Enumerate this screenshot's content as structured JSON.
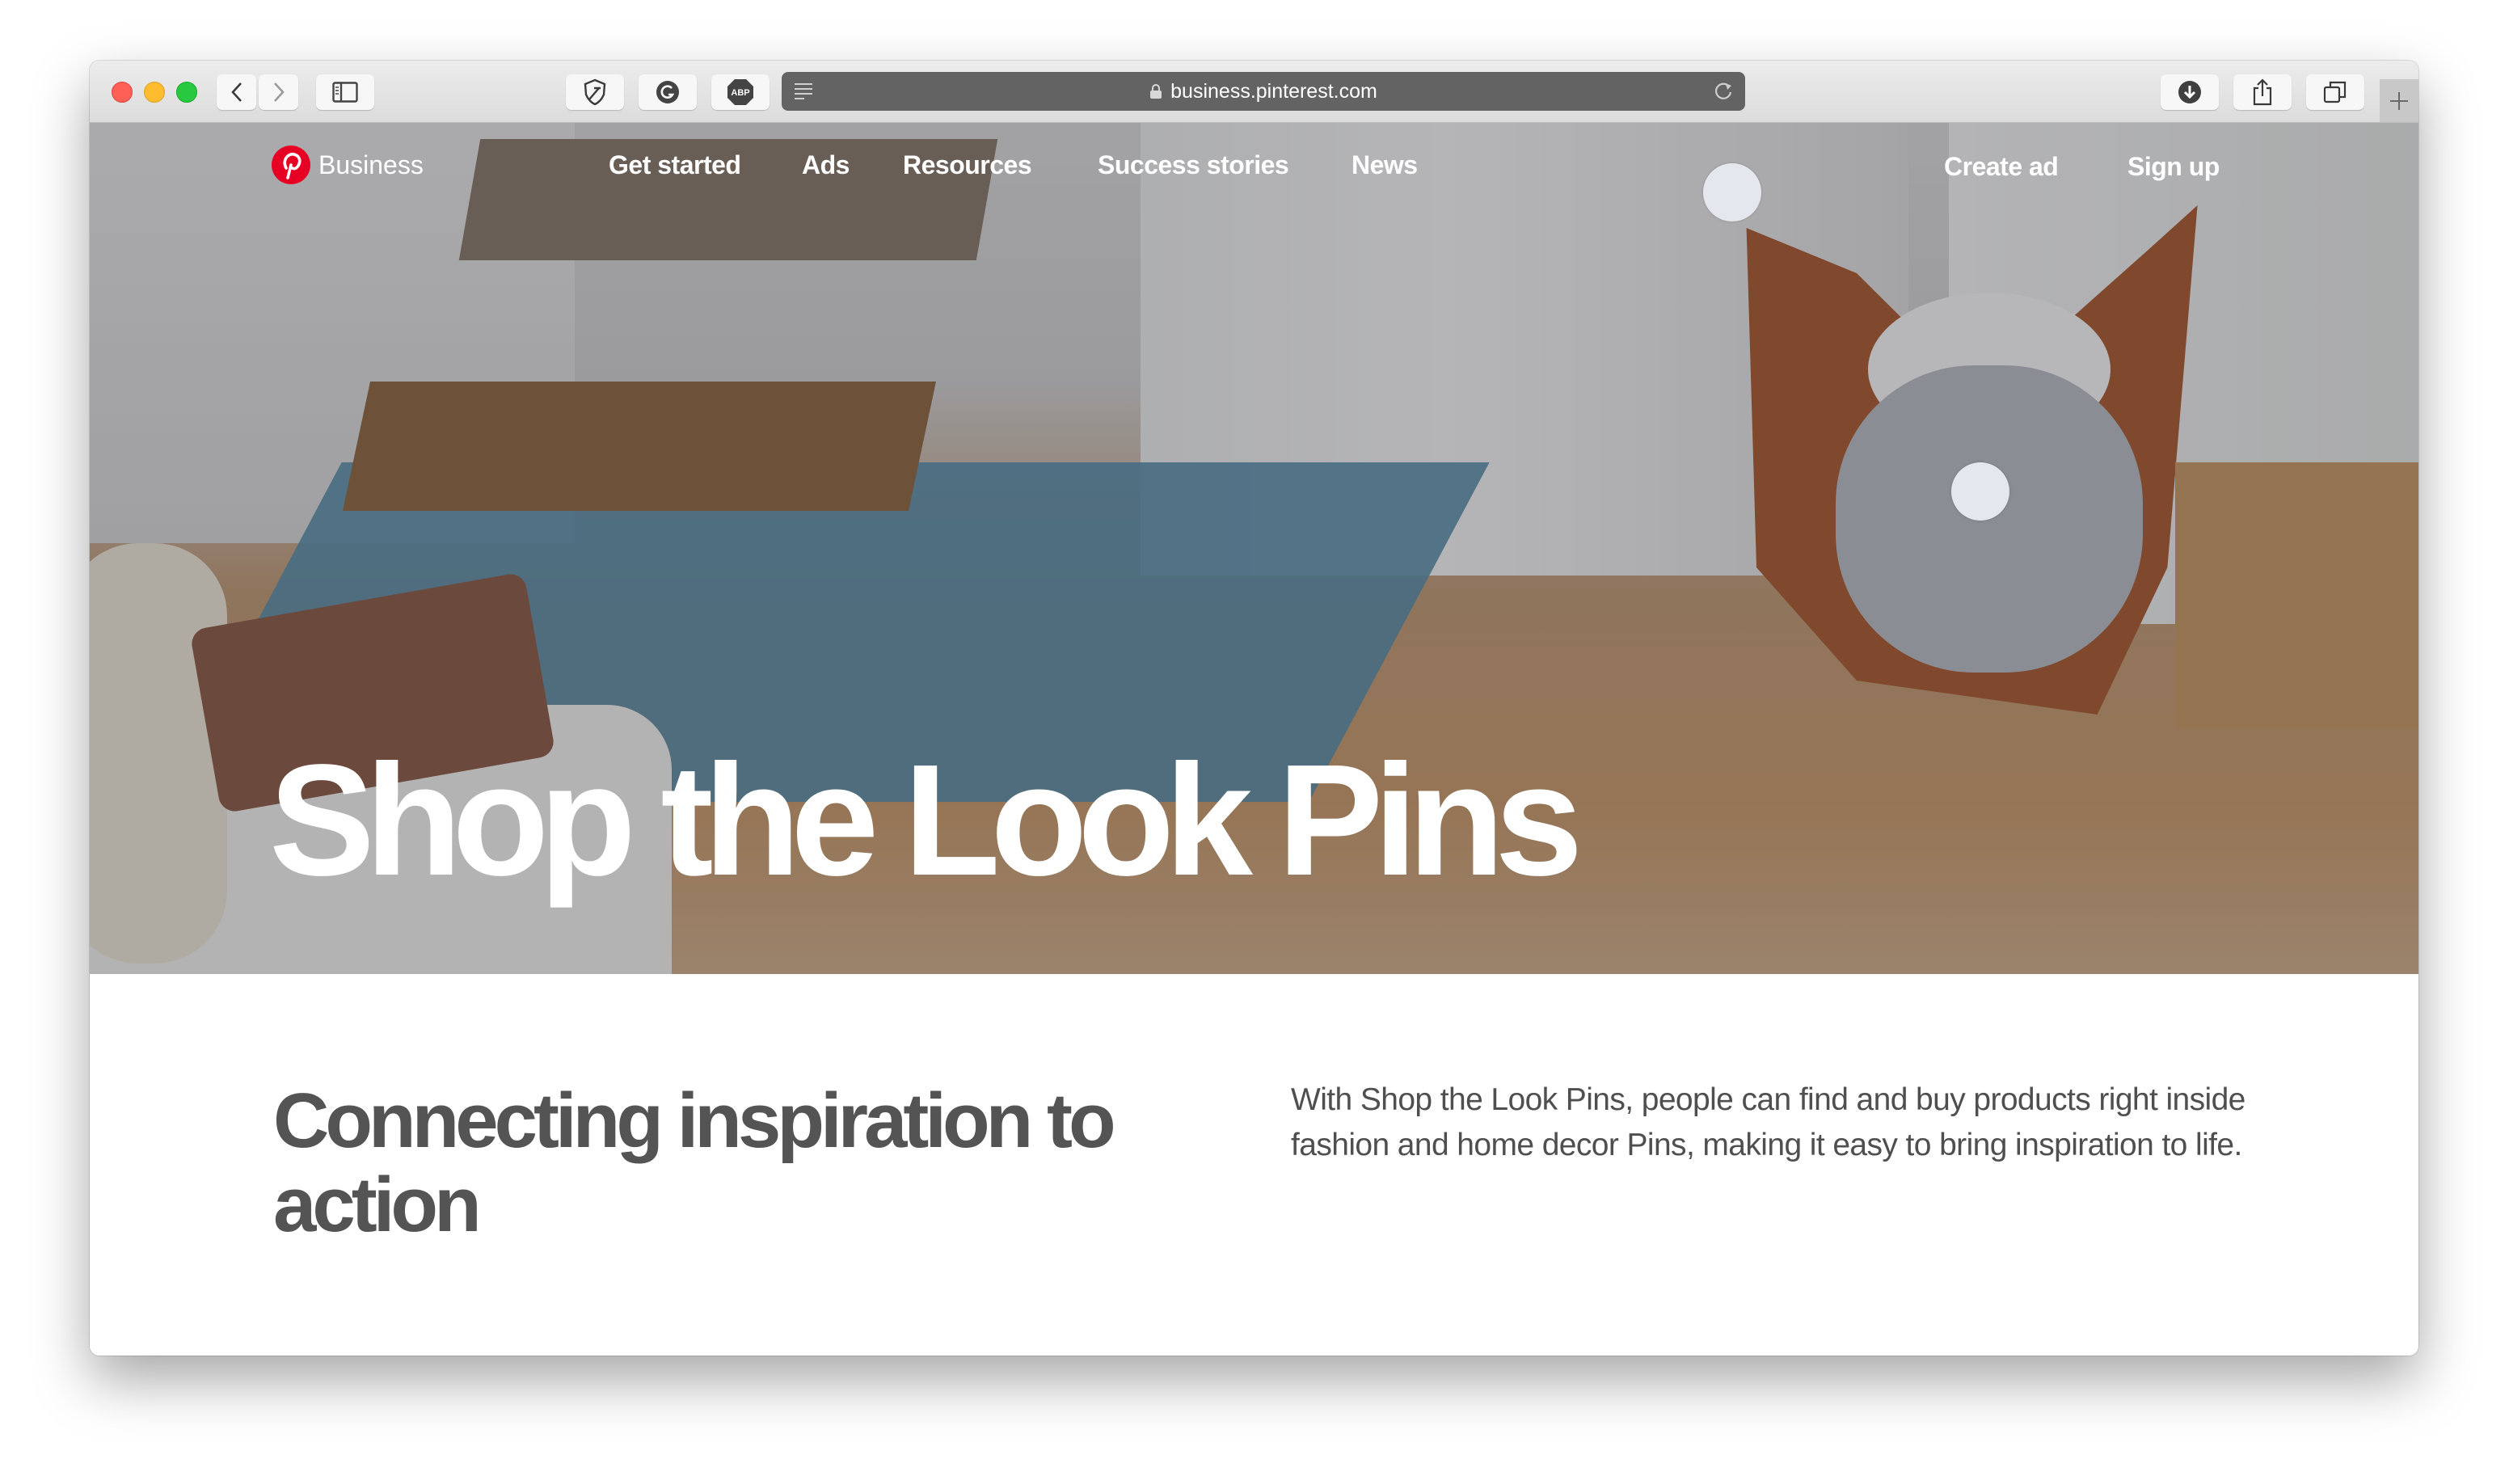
{
  "browser": {
    "url": "business.pinterest.com",
    "buttons": {
      "back": "back",
      "forward": "forward",
      "sidebar": "sidebar",
      "extension_1": "shield-extension",
      "extension_2": "grammarly-extension",
      "extension_3": "ABP",
      "download": "downloads",
      "share": "share",
      "tabs": "show-tabs",
      "new_tab": "+"
    }
  },
  "nav": {
    "logo_text": "Business",
    "links": [
      "Get started",
      "Ads",
      "Resources",
      "Success stories",
      "News"
    ],
    "actions": [
      "Create ad",
      "Sign up"
    ]
  },
  "hero": {
    "title": "Shop the Look Pins",
    "hotspots": 2
  },
  "content": {
    "heading": "Connecting inspiration to action",
    "body": "With Shop the Look Pins, people can find and buy products right inside fashion and home decor Pins, making it easy to bring inspiration to life."
  },
  "colors": {
    "brand_red": "#e60023",
    "heading_gray": "#545454",
    "body_gray": "#4f4f4f"
  }
}
